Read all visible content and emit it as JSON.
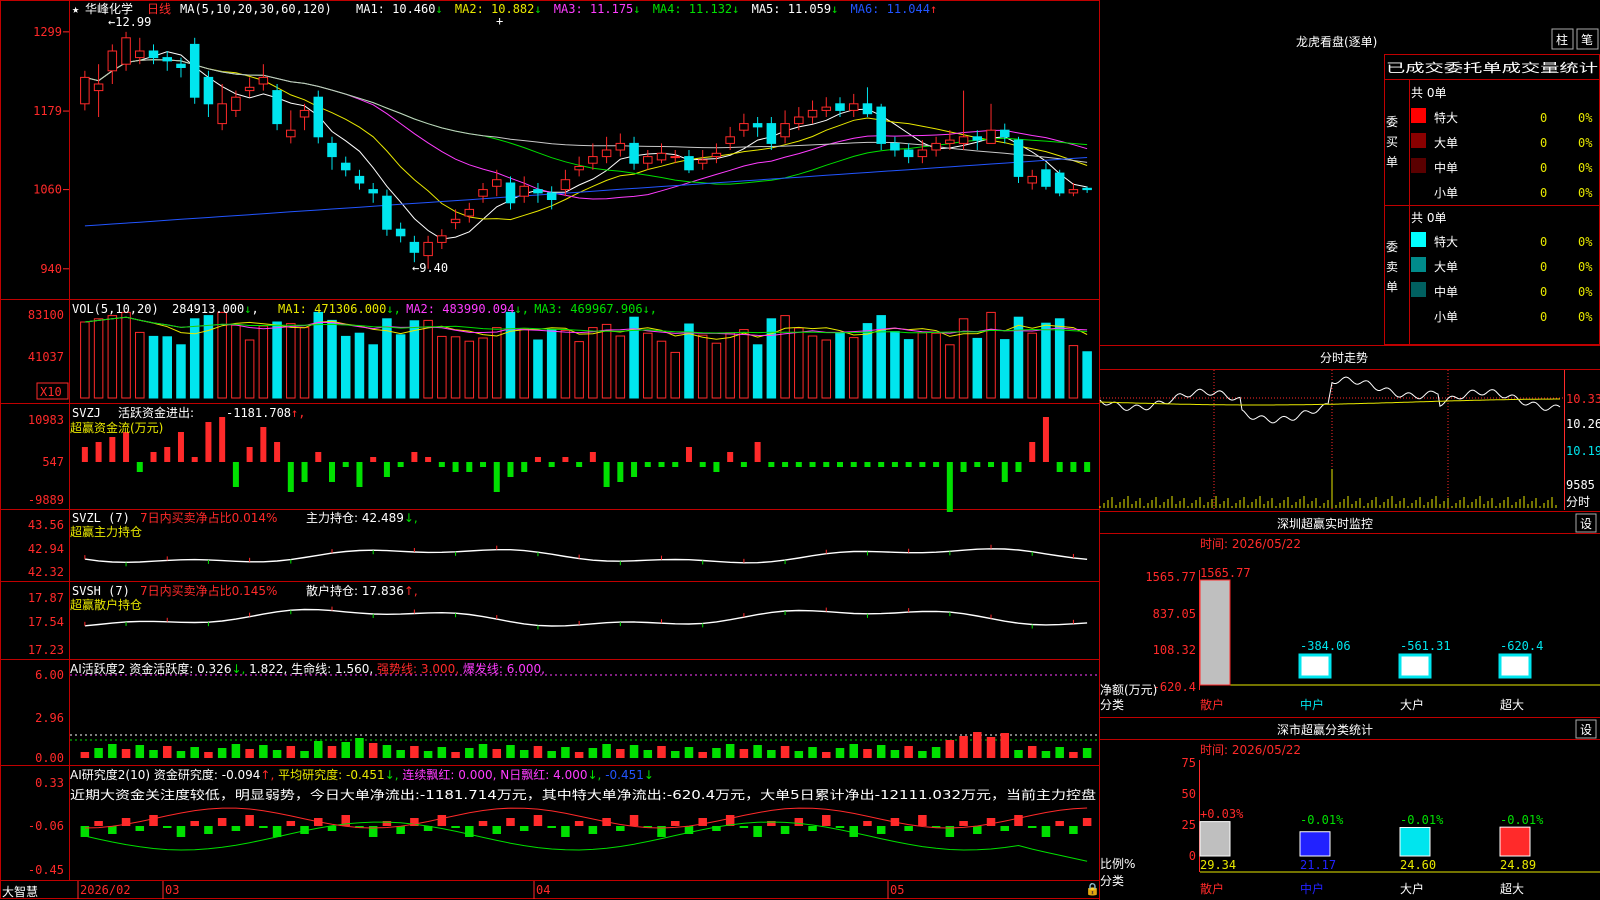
{
  "colors": {
    "up": "#ff2a2a",
    "down": "#00e5ee",
    "grid": "#c00000",
    "ma5": "#ffffff",
    "ma10": "#e8e800",
    "ma20": "#ff3cff",
    "ma30": "#00e000",
    "ma60": "#c8c8c8",
    "ma120": "#2255ff",
    "bar_green": "#00e000",
    "bar_red": "#ff2a2a"
  },
  "toolbar": {
    "star_icon": "star-icon",
    "stock_name": "华峰化学",
    "period": "日线"
  },
  "main_pane": {
    "ma_params": "MA(5,10,20,30,60,120)",
    "ma_items": [
      {
        "label": "MA1:",
        "value": "10.460",
        "arrow": "↓",
        "color": "#ffffff"
      },
      {
        "label": "MA2:",
        "value": "10.882",
        "arrow": "↓",
        "color": "#e8e800"
      },
      {
        "label": "MA3:",
        "value": "11.175",
        "arrow": "↓",
        "color": "#ff3cff"
      },
      {
        "label": "MA4:",
        "value": "11.132",
        "arrow": "↓",
        "color": "#00e000"
      },
      {
        "label": "MA5:",
        "value": "11.059",
        "arrow": "↓",
        "color": "#ffffff"
      },
      {
        "label": "MA6:",
        "value": "11.044",
        "arrow": "↑",
        "color": "#2255ff"
      }
    ],
    "y_ticks": [
      "1299",
      "1179",
      "1060",
      "940"
    ],
    "high_label": "12.99",
    "low_label": "9.40"
  },
  "volume_pane": {
    "params": "VOL(5,10,20)",
    "vol_value": "284913.000",
    "items": [
      {
        "label": "MA1:",
        "value": "471306.000",
        "arrow": "↓",
        "color": "#e8e800"
      },
      {
        "label": "MA2:",
        "value": "483990.094",
        "arrow": "↓",
        "color": "#ff3cff"
      },
      {
        "label": "MA3:",
        "value": "469967.906",
        "arrow": "↓",
        "color": "#00e000"
      }
    ],
    "y_ticks": [
      "83100",
      "41037"
    ],
    "unit": "X10"
  },
  "svzj_pane": {
    "name": "SVZJ",
    "label": "活跃资金进出:",
    "value": "-1181.708",
    "arrow": "↑,",
    "subtitle": "超赢资金流(万元)",
    "y_ticks": [
      "10983",
      "547",
      "-9889"
    ]
  },
  "svzl_pane": {
    "name": "SVZL (7)",
    "ratio_label": "7日内买卖净占比0.014%",
    "hold_label": "主力持仓:",
    "hold_value": "42.489",
    "arrow": "↓,",
    "subtitle": "超赢主力持仓",
    "y_ticks": [
      "43.56",
      "42.94",
      "42.32"
    ]
  },
  "svsh_pane": {
    "name": "SVSH (7)",
    "ratio_label": "7日内买卖净占比0.145%",
    "hold_label": "散户持仓:",
    "hold_value": "17.836",
    "arrow": "↑,",
    "subtitle": "超赢散户持仓",
    "y_ticks": [
      "17.87",
      "17.54",
      "17.23"
    ]
  },
  "ai_active_pane": {
    "name": "AI活跃度2",
    "label": "资金活跃度:",
    "value": "0.326",
    "arrow": "↓,",
    "value2": "1.822,",
    "life_label": "生命线:",
    "life_value": "1.560,",
    "strong_label": "强势线:",
    "strong_value": "3.000,",
    "burst_label": "爆发线:",
    "burst_value": "6.000,",
    "y_ticks": [
      "6.00",
      "2.96",
      "0.00"
    ]
  },
  "ai_research_pane": {
    "name": "AI研究度2(10)",
    "label": "资金研究度:",
    "value": "-0.094",
    "arrow": "↑,",
    "avg_label": "平均研究度:",
    "avg_value": "-0.451",
    "avg_arrow": "↓,",
    "red_label": "连续飘红:",
    "red_value": "0.000,",
    "nred_label": "N日飘红:",
    "nred_value": "4.000",
    "nred_arrow": "↓,",
    "last_value": "-0.451",
    "last_arrow": "↓",
    "comment": "近期大资金关注度较低，明显弱势，今日大单净流出:-1181.714万元，其中特大单净流出:-620.4万元，大单5日累计净出-12111.032万元，当前主力控盘",
    "y_ticks": [
      "0.33",
      "-0.06",
      "-0.45"
    ]
  },
  "x_axis": {
    "labels": [
      "2026/02",
      "03",
      "04",
      "05"
    ],
    "brand": "大智慧"
  },
  "side_panel": {
    "title": "龙虎看盘(逐单)",
    "btn_column": "柱",
    "btn_stroke": "笔",
    "table_title": "已成交委托单成交量统计",
    "buy_group": {
      "label": "委买单",
      "total": "共 0单",
      "rows": [
        {
          "name": "特大",
          "count": "0",
          "pct": "0%",
          "color": "#ff0000"
        },
        {
          "name": "大单",
          "count": "0",
          "pct": "0%",
          "color": "#8b0000"
        },
        {
          "name": "中单",
          "count": "0",
          "pct": "0%",
          "color": "#5a0000"
        },
        {
          "name": "小单",
          "count": "0",
          "pct": "0%",
          "color": "#000000"
        }
      ]
    },
    "sell_group": {
      "label": "委卖单",
      "total": "共 0单",
      "rows": [
        {
          "name": "特大",
          "count": "0",
          "pct": "0%",
          "color": "#00ffff"
        },
        {
          "name": "大单",
          "count": "0",
          "pct": "0%",
          "color": "#008b8b"
        },
        {
          "name": "中单",
          "count": "0",
          "pct": "0%",
          "color": "#006060"
        },
        {
          "name": "小单",
          "count": "0",
          "pct": "0%",
          "color": "#000000"
        }
      ]
    },
    "intraday_title": "分时走势",
    "intraday_ticks": [
      "10.33",
      "10.26",
      "10.19",
      "9585",
      "分时"
    ],
    "monitor": {
      "title": "深圳超赢实时监控",
      "setting": "设",
      "time": "时间: 2026/05/22",
      "y_ticks": [
        "1565.77",
        "837.05",
        "108.32",
        "-620.4"
      ],
      "y_unit": "净额(万元)",
      "x_unit": "分类",
      "bars": [
        {
          "name": "散户",
          "value": "1565.77"
        },
        {
          "name": "中户",
          "value": "-384.06"
        },
        {
          "name": "大户",
          "value": "-561.31"
        },
        {
          "name": "超大",
          "value": "-620.4"
        }
      ]
    },
    "classify": {
      "title": "深市超赢分类统计",
      "setting": "设",
      "time": "时间: 2026/05/22",
      "y_ticks": [
        "75",
        "50",
        "25",
        "0"
      ],
      "y_unit": "比例%",
      "x_unit": "分类",
      "bars": [
        {
          "name": "散户",
          "delta": "+0.03%",
          "value": "29.34"
        },
        {
          "name": "中户",
          "delta": "-0.01%",
          "value": "21.17"
        },
        {
          "name": "大户",
          "delta": "-0.01%",
          "value": "24.60"
        },
        {
          "name": "超大",
          "delta": "-0.01%",
          "value": "24.89"
        }
      ]
    }
  },
  "chart_data": {
    "type": "candlestick",
    "ylim": [
      9.2,
      13.2
    ],
    "candles": [
      [
        11.9,
        12.3,
        12.4,
        11.8
      ],
      [
        12.1,
        12.2,
        12.5,
        11.7
      ],
      [
        12.4,
        12.7,
        12.8,
        12.2
      ],
      [
        12.5,
        12.9,
        12.99,
        12.4
      ],
      [
        12.6,
        12.7,
        12.9,
        12.5
      ],
      [
        12.7,
        12.6,
        12.8,
        12.5
      ],
      [
        12.6,
        12.55,
        12.7,
        12.4
      ],
      [
        12.5,
        12.45,
        12.6,
        12.3
      ],
      [
        12.8,
        12.0,
        12.9,
        11.9
      ],
      [
        12.3,
        11.9,
        12.4,
        11.7
      ],
      [
        11.6,
        11.9,
        12.2,
        11.5
      ],
      [
        11.8,
        12.0,
        12.1,
        11.7
      ],
      [
        12.1,
        12.15,
        12.3,
        12.0
      ],
      [
        12.2,
        12.3,
        12.5,
        12.1
      ],
      [
        12.1,
        11.6,
        12.2,
        11.5
      ],
      [
        11.4,
        11.5,
        11.8,
        11.3
      ],
      [
        11.7,
        11.8,
        11.9,
        11.5
      ],
      [
        12.0,
        11.4,
        12.1,
        11.3
      ],
      [
        11.3,
        11.1,
        11.4,
        10.9
      ],
      [
        11.0,
        10.9,
        11.1,
        10.8
      ],
      [
        10.8,
        10.7,
        10.9,
        10.6
      ],
      [
        10.6,
        10.55,
        10.7,
        10.4
      ],
      [
        10.5,
        10.0,
        10.6,
        9.9
      ],
      [
        10.0,
        9.9,
        10.1,
        9.8
      ],
      [
        9.8,
        9.65,
        9.9,
        9.5
      ],
      [
        9.6,
        9.8,
        9.9,
        9.4
      ],
      [
        9.8,
        9.9,
        10.0,
        9.7
      ],
      [
        10.1,
        10.15,
        10.3,
        10.0
      ],
      [
        10.2,
        10.3,
        10.4,
        10.1
      ],
      [
        10.5,
        10.6,
        10.7,
        10.4
      ],
      [
        10.65,
        10.75,
        10.9,
        10.5
      ],
      [
        10.7,
        10.4,
        10.8,
        10.3
      ],
      [
        10.5,
        10.65,
        10.8,
        10.4
      ],
      [
        10.6,
        10.55,
        10.7,
        10.4
      ],
      [
        10.55,
        10.45,
        10.65,
        10.3
      ],
      [
        10.6,
        10.75,
        10.9,
        10.5
      ],
      [
        10.9,
        10.95,
        11.1,
        10.8
      ],
      [
        11.0,
        11.1,
        11.3,
        10.9
      ],
      [
        11.1,
        11.2,
        11.4,
        11.0
      ],
      [
        11.2,
        11.3,
        11.45,
        11.1
      ],
      [
        11.3,
        11.0,
        11.4,
        10.9
      ],
      [
        11.0,
        11.1,
        11.2,
        10.9
      ],
      [
        11.05,
        11.15,
        11.3,
        11.0
      ],
      [
        11.1,
        11.1,
        11.2,
        11.0
      ],
      [
        11.1,
        10.9,
        11.2,
        10.85
      ],
      [
        11.0,
        11.05,
        11.2,
        10.9
      ],
      [
        11.1,
        11.15,
        11.3,
        11.0
      ],
      [
        11.3,
        11.4,
        11.55,
        11.2
      ],
      [
        11.5,
        11.6,
        11.75,
        11.4
      ],
      [
        11.6,
        11.55,
        11.7,
        11.4
      ],
      [
        11.6,
        11.3,
        11.7,
        11.2
      ],
      [
        11.4,
        11.6,
        11.8,
        11.3
      ],
      [
        11.6,
        11.7,
        11.85,
        11.5
      ],
      [
        11.7,
        11.8,
        11.95,
        11.6
      ],
      [
        11.8,
        11.85,
        12.0,
        11.7
      ],
      [
        11.9,
        11.8,
        12.0,
        11.7
      ],
      [
        11.8,
        11.9,
        12.05,
        11.7
      ],
      [
        11.9,
        11.75,
        12.15,
        11.7
      ],
      [
        11.85,
        11.3,
        11.9,
        11.2
      ],
      [
        11.3,
        11.2,
        11.4,
        11.1
      ],
      [
        11.2,
        11.1,
        11.3,
        11.0
      ],
      [
        11.1,
        11.2,
        11.35,
        11.0
      ],
      [
        11.2,
        11.3,
        11.4,
        11.1
      ],
      [
        11.3,
        11.35,
        11.5,
        11.2
      ],
      [
        11.3,
        11.4,
        12.1,
        11.2
      ],
      [
        11.4,
        11.35,
        11.5,
        11.2
      ],
      [
        11.3,
        11.5,
        11.9,
        11.3
      ],
      [
        11.5,
        11.4,
        11.6,
        11.3
      ],
      [
        11.35,
        10.8,
        11.4,
        10.7
      ],
      [
        10.7,
        10.8,
        10.9,
        10.6
      ],
      [
        10.9,
        10.65,
        11.0,
        10.6
      ],
      [
        10.85,
        10.55,
        10.9,
        10.5
      ],
      [
        10.55,
        10.6,
        10.7,
        10.5
      ],
      [
        10.62,
        10.6,
        10.65,
        10.55
      ]
    ]
  }
}
